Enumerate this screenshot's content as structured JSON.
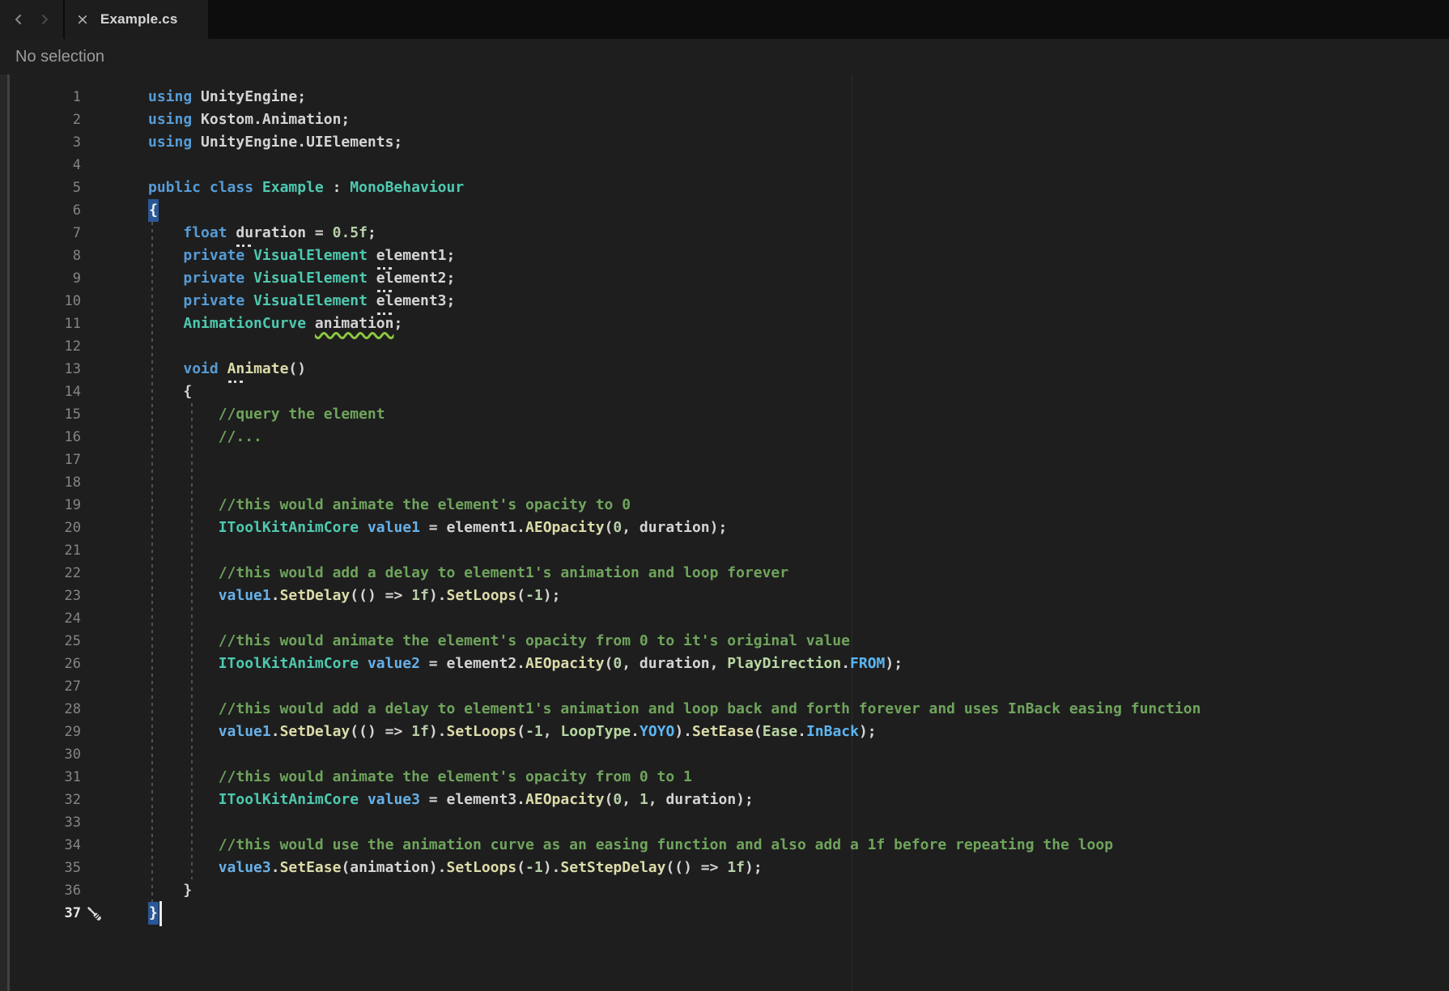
{
  "window": {
    "tab": {
      "label": "Example.cs",
      "close_glyph": "×"
    }
  },
  "breadcrumb": {
    "text": "No selection"
  },
  "colors": {
    "background": "#1E1E1E",
    "tab_strip": "#0D0D0D",
    "tab_background": "#1D1D1D",
    "keyword": "#569CD6",
    "class_type": "#4EC9B0",
    "enum_type": "#B8D7A3",
    "method": "#DCDCAA",
    "local_variable": "#67B1E8",
    "enum_member": "#5CB6F2",
    "number": "#B5CEA8",
    "plain_text": "#D4D4D4",
    "comment": "#6FA45C",
    "line_number": "#858585",
    "line_number_active": "#E8E8E8",
    "bracket_match": "#2A5796",
    "warning_squiggle": "#8CC63F",
    "breadcrumb_text": "#9C9C9C"
  },
  "editor": {
    "lines": [
      {
        "n": "1",
        "tokens": [
          [
            "kw",
            "using"
          ],
          [
            "txt",
            " UnityEngine;"
          ]
        ]
      },
      {
        "n": "2",
        "tokens": [
          [
            "kw",
            "using"
          ],
          [
            "txt",
            " Kostom.Animation;"
          ]
        ]
      },
      {
        "n": "3",
        "tokens": [
          [
            "kw",
            "using"
          ],
          [
            "txt",
            " UnityEngine.UIElements;"
          ]
        ]
      },
      {
        "n": "4",
        "tokens": []
      },
      {
        "n": "5",
        "tokens": [
          [
            "kw",
            "public"
          ],
          [
            "txt",
            " "
          ],
          [
            "kw",
            "class"
          ],
          [
            "txt",
            " "
          ],
          [
            "type",
            "Example"
          ],
          [
            "txt",
            " : "
          ],
          [
            "type",
            "MonoBehaviour"
          ]
        ]
      },
      {
        "n": "6",
        "tokens": [
          [
            "brace",
            "{"
          ]
        ]
      },
      {
        "n": "7",
        "tokens": [
          [
            "txt",
            "    "
          ],
          [
            "kw",
            "float"
          ],
          [
            "txt",
            " "
          ],
          [
            "txt dots",
            "duration"
          ],
          [
            "txt",
            " = "
          ],
          [
            "num-lit",
            "0.5f"
          ],
          [
            "txt",
            ";"
          ]
        ]
      },
      {
        "n": "8",
        "tokens": [
          [
            "txt",
            "    "
          ],
          [
            "kw",
            "private"
          ],
          [
            "txt",
            " "
          ],
          [
            "type",
            "VisualElement"
          ],
          [
            "txt",
            " "
          ],
          [
            "txt dots",
            "element1"
          ],
          [
            "txt",
            ";"
          ]
        ]
      },
      {
        "n": "9",
        "tokens": [
          [
            "txt",
            "    "
          ],
          [
            "kw",
            "private"
          ],
          [
            "txt",
            " "
          ],
          [
            "type",
            "VisualElement"
          ],
          [
            "txt",
            " "
          ],
          [
            "txt dots",
            "element2"
          ],
          [
            "txt",
            ";"
          ]
        ]
      },
      {
        "n": "10",
        "tokens": [
          [
            "txt",
            "    "
          ],
          [
            "kw",
            "private"
          ],
          [
            "txt",
            " "
          ],
          [
            "type",
            "VisualElement"
          ],
          [
            "txt",
            " "
          ],
          [
            "txt dots",
            "element3"
          ],
          [
            "txt",
            ";"
          ]
        ]
      },
      {
        "n": "11",
        "tokens": [
          [
            "txt",
            "    "
          ],
          [
            "type",
            "AnimationCurve"
          ],
          [
            "txt",
            " "
          ],
          [
            "txt squiggle",
            "animation"
          ],
          [
            "txt",
            ";"
          ]
        ]
      },
      {
        "n": "12",
        "tokens": []
      },
      {
        "n": "13",
        "tokens": [
          [
            "txt",
            "    "
          ],
          [
            "kw",
            "void"
          ],
          [
            "txt",
            " "
          ],
          [
            "method dots",
            "Animate"
          ],
          [
            "txt",
            "()"
          ]
        ]
      },
      {
        "n": "14",
        "tokens": [
          [
            "txt",
            "    {"
          ]
        ]
      },
      {
        "n": "15",
        "tokens": [
          [
            "txt",
            "        "
          ],
          [
            "com",
            "//query the element"
          ]
        ]
      },
      {
        "n": "16",
        "tokens": [
          [
            "txt",
            "        "
          ],
          [
            "com",
            "//..."
          ]
        ]
      },
      {
        "n": "17",
        "tokens": []
      },
      {
        "n": "18",
        "tokens": []
      },
      {
        "n": "19",
        "tokens": [
          [
            "txt",
            "        "
          ],
          [
            "com",
            "//this would animate the element's opacity to 0"
          ]
        ]
      },
      {
        "n": "20",
        "tokens": [
          [
            "txt",
            "        "
          ],
          [
            "type",
            "IToolKitAnimCore"
          ],
          [
            "txt",
            " "
          ],
          [
            "var",
            "value1"
          ],
          [
            "txt",
            " = element1."
          ],
          [
            "method",
            "AEOpacity"
          ],
          [
            "txt",
            "("
          ],
          [
            "num-lit",
            "0"
          ],
          [
            "txt",
            ", duration);"
          ]
        ]
      },
      {
        "n": "21",
        "tokens": []
      },
      {
        "n": "22",
        "tokens": [
          [
            "txt",
            "        "
          ],
          [
            "com",
            "//this would add a delay to element1's animation and loop forever"
          ]
        ]
      },
      {
        "n": "23",
        "tokens": [
          [
            "txt",
            "        "
          ],
          [
            "var",
            "value1"
          ],
          [
            "txt",
            "."
          ],
          [
            "method",
            "SetDelay"
          ],
          [
            "txt",
            "(() => "
          ],
          [
            "num-lit",
            "1f"
          ],
          [
            "txt",
            ")."
          ],
          [
            "method",
            "SetLoops"
          ],
          [
            "txt",
            "("
          ],
          [
            "num-lit",
            "-1"
          ],
          [
            "txt",
            ");"
          ]
        ]
      },
      {
        "n": "24",
        "tokens": []
      },
      {
        "n": "25",
        "tokens": [
          [
            "txt",
            "        "
          ],
          [
            "com",
            "//this would animate the element's opacity from 0 to it's original value"
          ]
        ]
      },
      {
        "n": "26",
        "tokens": [
          [
            "txt",
            "        "
          ],
          [
            "type",
            "IToolKitAnimCore"
          ],
          [
            "txt",
            " "
          ],
          [
            "var",
            "value2"
          ],
          [
            "txt",
            " = element2."
          ],
          [
            "method",
            "AEOpacity"
          ],
          [
            "txt",
            "("
          ],
          [
            "num-lit",
            "0"
          ],
          [
            "txt",
            ", duration, "
          ],
          [
            "enum",
            "PlayDirection"
          ],
          [
            "txt",
            "."
          ],
          [
            "emem",
            "FROM"
          ],
          [
            "txt",
            ");"
          ]
        ]
      },
      {
        "n": "27",
        "tokens": []
      },
      {
        "n": "28",
        "tokens": [
          [
            "txt",
            "        "
          ],
          [
            "com",
            "//this would add a delay to element1's animation and loop back and forth forever and uses InBack easing function"
          ]
        ]
      },
      {
        "n": "29",
        "tokens": [
          [
            "txt",
            "        "
          ],
          [
            "var",
            "value1"
          ],
          [
            "txt",
            "."
          ],
          [
            "method",
            "SetDelay"
          ],
          [
            "txt",
            "(() => "
          ],
          [
            "num-lit",
            "1f"
          ],
          [
            "txt",
            ")."
          ],
          [
            "method",
            "SetLoops"
          ],
          [
            "txt",
            "("
          ],
          [
            "num-lit",
            "-1"
          ],
          [
            "txt",
            ", "
          ],
          [
            "enum",
            "LoopType"
          ],
          [
            "txt",
            "."
          ],
          [
            "emem",
            "YOYO"
          ],
          [
            "txt",
            ")."
          ],
          [
            "method",
            "SetEase"
          ],
          [
            "txt",
            "("
          ],
          [
            "enum",
            "Ease"
          ],
          [
            "txt",
            "."
          ],
          [
            "emem",
            "InBack"
          ],
          [
            "txt",
            ");"
          ]
        ]
      },
      {
        "n": "30",
        "tokens": []
      },
      {
        "n": "31",
        "tokens": [
          [
            "txt",
            "        "
          ],
          [
            "com",
            "//this would animate the element's opacity from 0 to 1"
          ]
        ]
      },
      {
        "n": "32",
        "tokens": [
          [
            "txt",
            "        "
          ],
          [
            "type",
            "IToolKitAnimCore"
          ],
          [
            "txt",
            " "
          ],
          [
            "var",
            "value3"
          ],
          [
            "txt",
            " = element3."
          ],
          [
            "method",
            "AEOpacity"
          ],
          [
            "txt",
            "("
          ],
          [
            "num-lit",
            "0"
          ],
          [
            "txt",
            ", "
          ],
          [
            "num-lit",
            "1"
          ],
          [
            "txt",
            ", duration);"
          ]
        ]
      },
      {
        "n": "33",
        "tokens": []
      },
      {
        "n": "34",
        "tokens": [
          [
            "txt",
            "        "
          ],
          [
            "com",
            "//this would use the animation curve as an easing function and also add a 1f before repeating the loop"
          ]
        ]
      },
      {
        "n": "35",
        "tokens": [
          [
            "txt",
            "        "
          ],
          [
            "var",
            "value3"
          ],
          [
            "txt",
            "."
          ],
          [
            "method",
            "SetEase"
          ],
          [
            "txt",
            "(animation)."
          ],
          [
            "method",
            "SetLoops"
          ],
          [
            "txt",
            "("
          ],
          [
            "num-lit",
            "-1"
          ],
          [
            "txt",
            ")."
          ],
          [
            "method",
            "SetStepDelay"
          ],
          [
            "txt",
            "(() => "
          ],
          [
            "num-lit",
            "1f"
          ],
          [
            "txt",
            ");"
          ]
        ]
      },
      {
        "n": "36",
        "tokens": [
          [
            "txt",
            "    }"
          ]
        ]
      },
      {
        "n": "37",
        "active": true,
        "caret": true,
        "tokens": [
          [
            "brace",
            "}"
          ]
        ]
      }
    ]
  }
}
